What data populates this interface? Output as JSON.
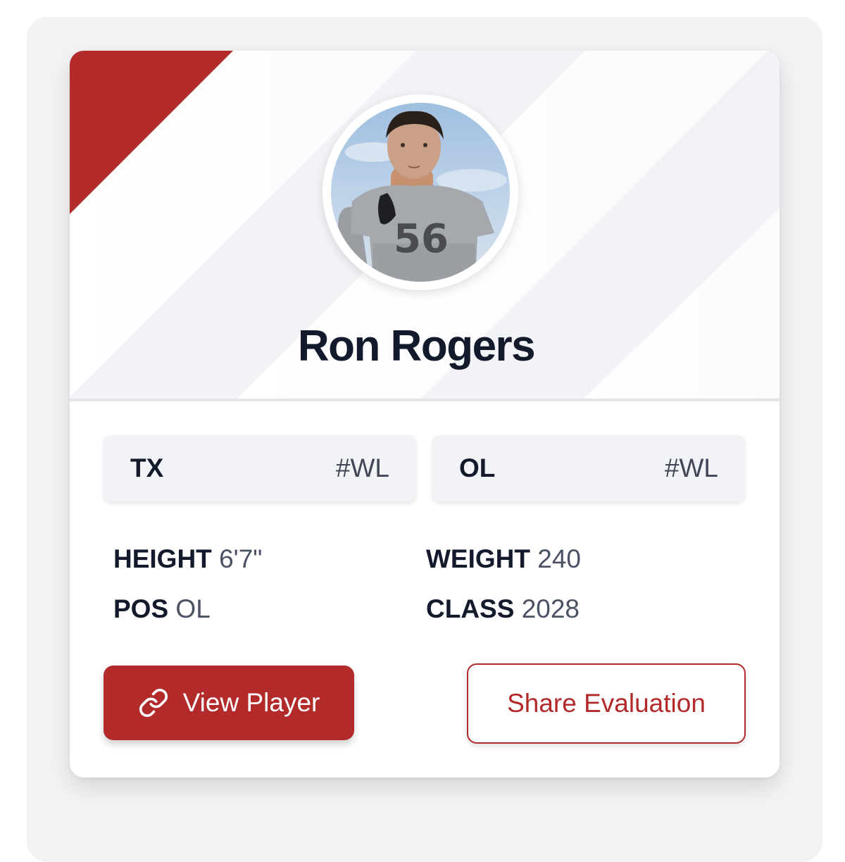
{
  "player": {
    "name": "Ron Rogers",
    "photo_alt": "Player photo",
    "jersey_number": "56"
  },
  "tags": [
    {
      "label": "TX",
      "rank": "#WL"
    },
    {
      "label": "OL",
      "rank": "#WL"
    }
  ],
  "stats": {
    "height": {
      "label": "HEIGHT",
      "value": "6'7\""
    },
    "weight": {
      "label": "WEIGHT",
      "value": "240"
    },
    "pos": {
      "label": "POS",
      "value": "OL"
    },
    "class": {
      "label": "CLASS",
      "value": "2028"
    }
  },
  "actions": {
    "view_player": "View Player",
    "view_player_icon": "link-icon",
    "share_evaluation": "Share Evaluation"
  },
  "colors": {
    "accent": "#b22a2a",
    "heading": "#131a2c",
    "muted_text": "#4a5162",
    "panel": "#f2f3f5"
  }
}
